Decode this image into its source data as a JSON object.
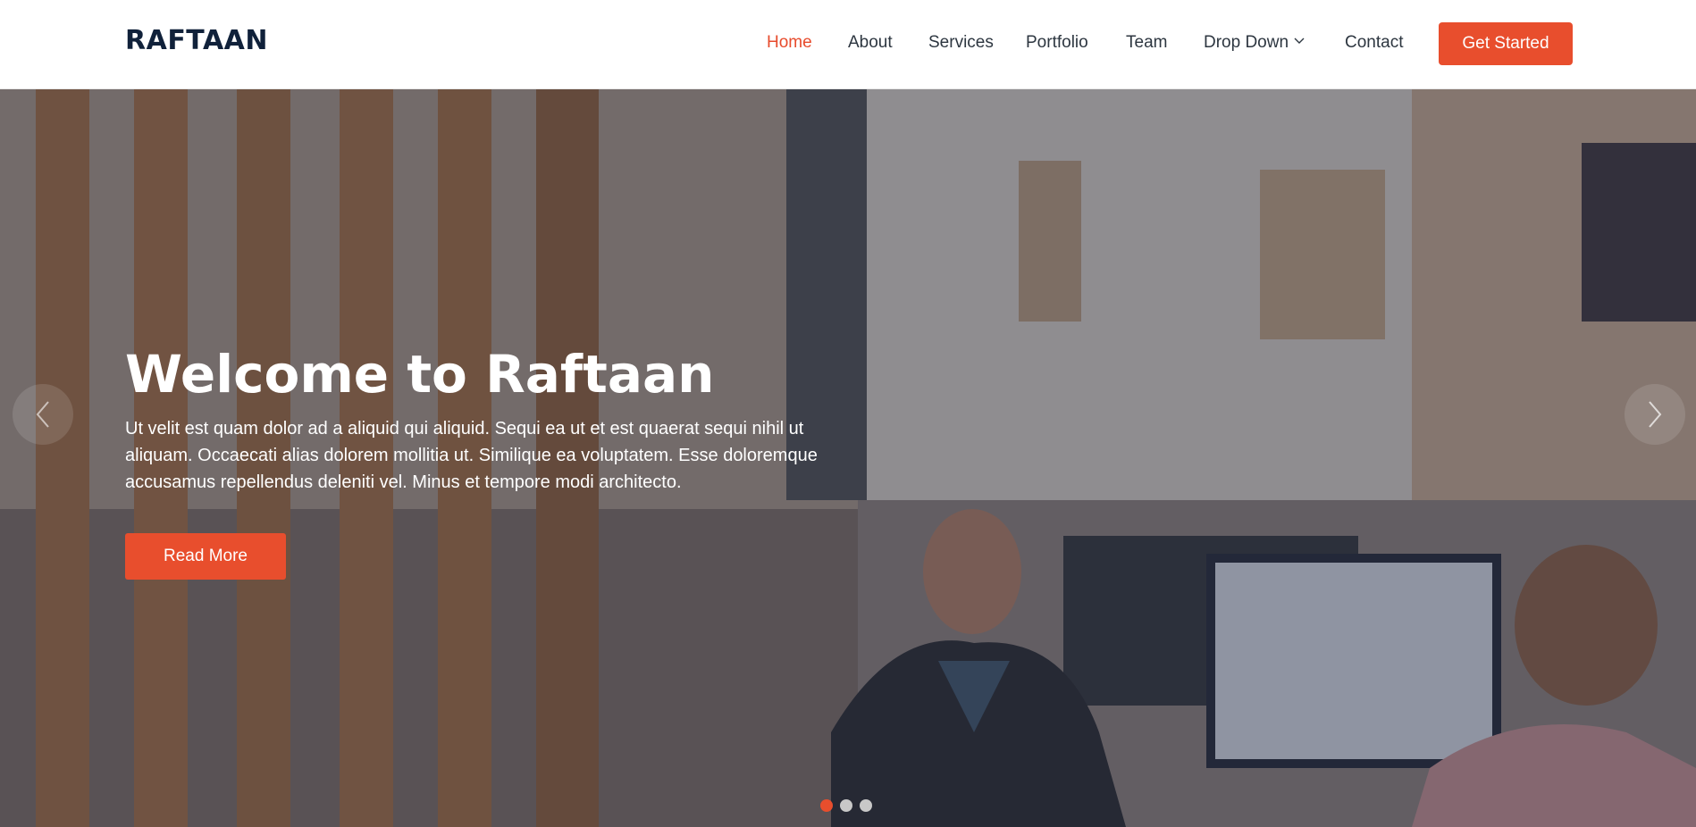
{
  "header": {
    "logo": "RAFTAAN",
    "nav": [
      {
        "label": "Home",
        "active": true
      },
      {
        "label": "About"
      },
      {
        "label": "Services"
      },
      {
        "label": "Portfolio"
      },
      {
        "label": "Team"
      },
      {
        "label": "Drop Down",
        "icon": "chevron-down-icon"
      },
      {
        "label": "Contact"
      }
    ],
    "cta_label": "Get Started"
  },
  "hero": {
    "title": "Welcome to Raftaan",
    "text": "Ut velit est quam dolor ad a aliquid qui aliquid. Sequi ea ut et est quaerat sequi nihil ut aliquam. Occaecati alias dolorem mollitia ut. Similique ea voluptatem. Esse doloremque accusamus repellendus deleniti vel. Minus et tempore modi architecto.",
    "button_label": "Read More",
    "prev_icon": "chevron-left-icon",
    "next_icon": "chevron-right-icon",
    "slides_total": 3,
    "active_slide": 1
  },
  "colors": {
    "accent": "#e84e2d",
    "logo": "#10213a",
    "nav_text": "#2d3640"
  }
}
